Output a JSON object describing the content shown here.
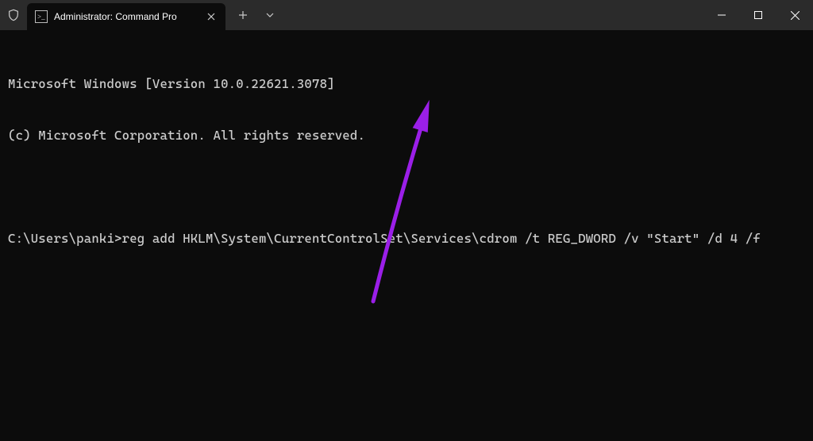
{
  "window": {
    "tab_title": "Administrator: Command Pro",
    "shield_icon": "shield-icon",
    "cmd_icon": "terminal-icon"
  },
  "terminal": {
    "line1": "Microsoft Windows [Version 10.0.22621.3078]",
    "line2": "(c) Microsoft Corporation. All rights reserved.",
    "prompt": "C:\\Users\\panki>",
    "command": "reg add HKLM\\System\\CurrentControlSet\\Services\\cdrom /t REG_DWORD /v \"Start\" /d 4 /f"
  },
  "annotation": {
    "arrow_color": "#9b1fe8"
  }
}
